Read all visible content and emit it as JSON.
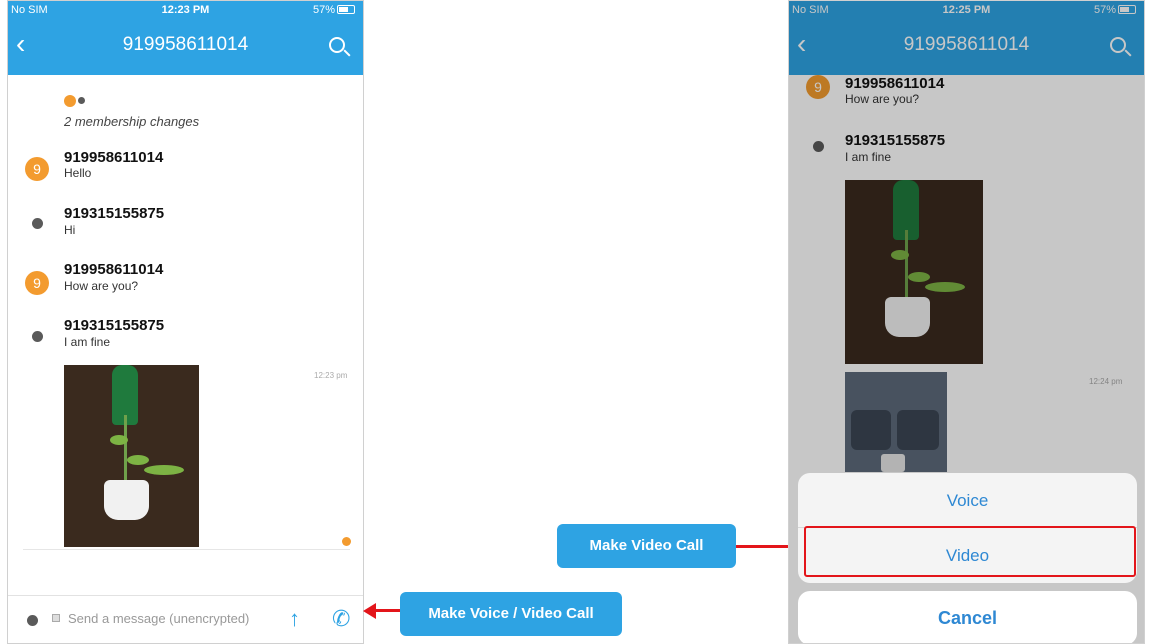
{
  "left_phone": {
    "status": {
      "carrier": "No SIM",
      "time": "12:23 PM",
      "battery": "57%"
    },
    "nav": {
      "back": "‹",
      "title": "919958611014"
    },
    "system_note": "2 membership changes",
    "messages": [
      {
        "sender": "919958611014",
        "text": "Hello",
        "avatar": "9"
      },
      {
        "sender": "919315155875",
        "text": "Hi"
      },
      {
        "sender": "919958611014",
        "text": "How are you?",
        "avatar": "9"
      },
      {
        "sender": "919315155875",
        "text": "I am fine"
      }
    ],
    "image_time": "12:23 pm",
    "input_placeholder": "Send a message (unencrypted)",
    "send_icon": "↑",
    "call_icon": "✆"
  },
  "right_phone": {
    "status": {
      "carrier": "No SIM",
      "time": "12:25 PM",
      "battery": "57%"
    },
    "nav": {
      "back": "‹",
      "title": "919958611014"
    },
    "messages": [
      {
        "sender": "919958611014",
        "text": "How are you?",
        "avatar": "9"
      },
      {
        "sender": "919315155875",
        "text": "I am fine"
      }
    ],
    "image_time": "12:24 pm",
    "sheet": {
      "voice": "Voice",
      "video": "Video",
      "cancel": "Cancel"
    }
  },
  "callouts": {
    "voice_video": "Make Voice / Video Call",
    "video": "Make Video Call"
  },
  "colors": {
    "accent": "#2ea3e3",
    "avatar_orange": "#f39b2f",
    "arrow_red": "#e3151a"
  }
}
